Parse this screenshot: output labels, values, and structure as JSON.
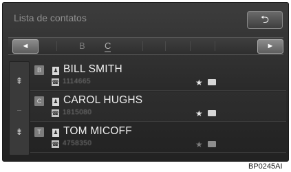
{
  "header": {
    "title": "Lista de contatos",
    "back_icon": "⮌"
  },
  "alphabet": {
    "left_arrow": "◄",
    "right_arrow": "►",
    "tabs": [
      {
        "label": "B"
      },
      {
        "label": "C"
      }
    ]
  },
  "scroll": {
    "up": "⇞",
    "down": "⇟"
  },
  "contacts": [
    {
      "letter": "B",
      "name": "BILL SMITH",
      "number": "1114665",
      "favorite": true
    },
    {
      "letter": "C",
      "name": "CAROL HUGHS",
      "number": "1815080",
      "favorite": true
    },
    {
      "letter": "T",
      "name": "TOM MICOFF",
      "number": "4758350",
      "favorite": false
    }
  ],
  "figure_code": "BP0245AI"
}
